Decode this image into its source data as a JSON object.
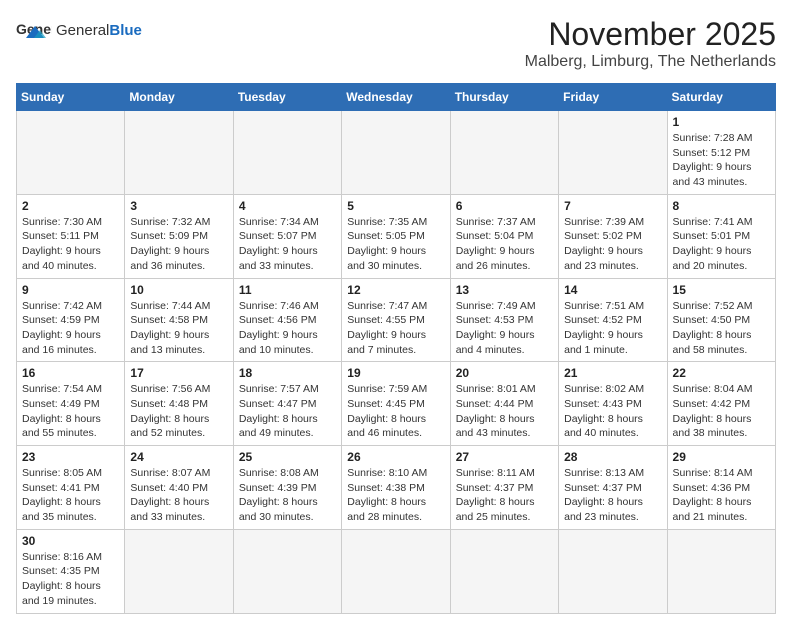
{
  "logo": {
    "text_general": "General",
    "text_blue": "Blue"
  },
  "title": "November 2025",
  "location": "Malberg, Limburg, The Netherlands",
  "weekdays": [
    "Sunday",
    "Monday",
    "Tuesday",
    "Wednesday",
    "Thursday",
    "Friday",
    "Saturday"
  ],
  "weeks": [
    [
      {
        "day": "",
        "info": "",
        "empty": true
      },
      {
        "day": "",
        "info": "",
        "empty": true
      },
      {
        "day": "",
        "info": "",
        "empty": true
      },
      {
        "day": "",
        "info": "",
        "empty": true
      },
      {
        "day": "",
        "info": "",
        "empty": true
      },
      {
        "day": "",
        "info": "",
        "empty": true
      },
      {
        "day": "1",
        "info": "Sunrise: 7:28 AM\nSunset: 5:12 PM\nDaylight: 9 hours and 43 minutes."
      }
    ],
    [
      {
        "day": "2",
        "info": "Sunrise: 7:30 AM\nSunset: 5:11 PM\nDaylight: 9 hours and 40 minutes."
      },
      {
        "day": "3",
        "info": "Sunrise: 7:32 AM\nSunset: 5:09 PM\nDaylight: 9 hours and 36 minutes."
      },
      {
        "day": "4",
        "info": "Sunrise: 7:34 AM\nSunset: 5:07 PM\nDaylight: 9 hours and 33 minutes."
      },
      {
        "day": "5",
        "info": "Sunrise: 7:35 AM\nSunset: 5:05 PM\nDaylight: 9 hours and 30 minutes."
      },
      {
        "day": "6",
        "info": "Sunrise: 7:37 AM\nSunset: 5:04 PM\nDaylight: 9 hours and 26 minutes."
      },
      {
        "day": "7",
        "info": "Sunrise: 7:39 AM\nSunset: 5:02 PM\nDaylight: 9 hours and 23 minutes."
      },
      {
        "day": "8",
        "info": "Sunrise: 7:41 AM\nSunset: 5:01 PM\nDaylight: 9 hours and 20 minutes."
      }
    ],
    [
      {
        "day": "9",
        "info": "Sunrise: 7:42 AM\nSunset: 4:59 PM\nDaylight: 9 hours and 16 minutes."
      },
      {
        "day": "10",
        "info": "Sunrise: 7:44 AM\nSunset: 4:58 PM\nDaylight: 9 hours and 13 minutes."
      },
      {
        "day": "11",
        "info": "Sunrise: 7:46 AM\nSunset: 4:56 PM\nDaylight: 9 hours and 10 minutes."
      },
      {
        "day": "12",
        "info": "Sunrise: 7:47 AM\nSunset: 4:55 PM\nDaylight: 9 hours and 7 minutes."
      },
      {
        "day": "13",
        "info": "Sunrise: 7:49 AM\nSunset: 4:53 PM\nDaylight: 9 hours and 4 minutes."
      },
      {
        "day": "14",
        "info": "Sunrise: 7:51 AM\nSunset: 4:52 PM\nDaylight: 9 hours and 1 minute."
      },
      {
        "day": "15",
        "info": "Sunrise: 7:52 AM\nSunset: 4:50 PM\nDaylight: 8 hours and 58 minutes."
      }
    ],
    [
      {
        "day": "16",
        "info": "Sunrise: 7:54 AM\nSunset: 4:49 PM\nDaylight: 8 hours and 55 minutes."
      },
      {
        "day": "17",
        "info": "Sunrise: 7:56 AM\nSunset: 4:48 PM\nDaylight: 8 hours and 52 minutes."
      },
      {
        "day": "18",
        "info": "Sunrise: 7:57 AM\nSunset: 4:47 PM\nDaylight: 8 hours and 49 minutes."
      },
      {
        "day": "19",
        "info": "Sunrise: 7:59 AM\nSunset: 4:45 PM\nDaylight: 8 hours and 46 minutes."
      },
      {
        "day": "20",
        "info": "Sunrise: 8:01 AM\nSunset: 4:44 PM\nDaylight: 8 hours and 43 minutes."
      },
      {
        "day": "21",
        "info": "Sunrise: 8:02 AM\nSunset: 4:43 PM\nDaylight: 8 hours and 40 minutes."
      },
      {
        "day": "22",
        "info": "Sunrise: 8:04 AM\nSunset: 4:42 PM\nDaylight: 8 hours and 38 minutes."
      }
    ],
    [
      {
        "day": "23",
        "info": "Sunrise: 8:05 AM\nSunset: 4:41 PM\nDaylight: 8 hours and 35 minutes."
      },
      {
        "day": "24",
        "info": "Sunrise: 8:07 AM\nSunset: 4:40 PM\nDaylight: 8 hours and 33 minutes."
      },
      {
        "day": "25",
        "info": "Sunrise: 8:08 AM\nSunset: 4:39 PM\nDaylight: 8 hours and 30 minutes."
      },
      {
        "day": "26",
        "info": "Sunrise: 8:10 AM\nSunset: 4:38 PM\nDaylight: 8 hours and 28 minutes."
      },
      {
        "day": "27",
        "info": "Sunrise: 8:11 AM\nSunset: 4:37 PM\nDaylight: 8 hours and 25 minutes."
      },
      {
        "day": "28",
        "info": "Sunrise: 8:13 AM\nSunset: 4:37 PM\nDaylight: 8 hours and 23 minutes."
      },
      {
        "day": "29",
        "info": "Sunrise: 8:14 AM\nSunset: 4:36 PM\nDaylight: 8 hours and 21 minutes."
      }
    ],
    [
      {
        "day": "30",
        "info": "Sunrise: 8:16 AM\nSunset: 4:35 PM\nDaylight: 8 hours and 19 minutes."
      },
      {
        "day": "",
        "info": "",
        "empty": true
      },
      {
        "day": "",
        "info": "",
        "empty": true
      },
      {
        "day": "",
        "info": "",
        "empty": true
      },
      {
        "day": "",
        "info": "",
        "empty": true
      },
      {
        "day": "",
        "info": "",
        "empty": true
      },
      {
        "day": "",
        "info": "",
        "empty": true
      }
    ]
  ]
}
